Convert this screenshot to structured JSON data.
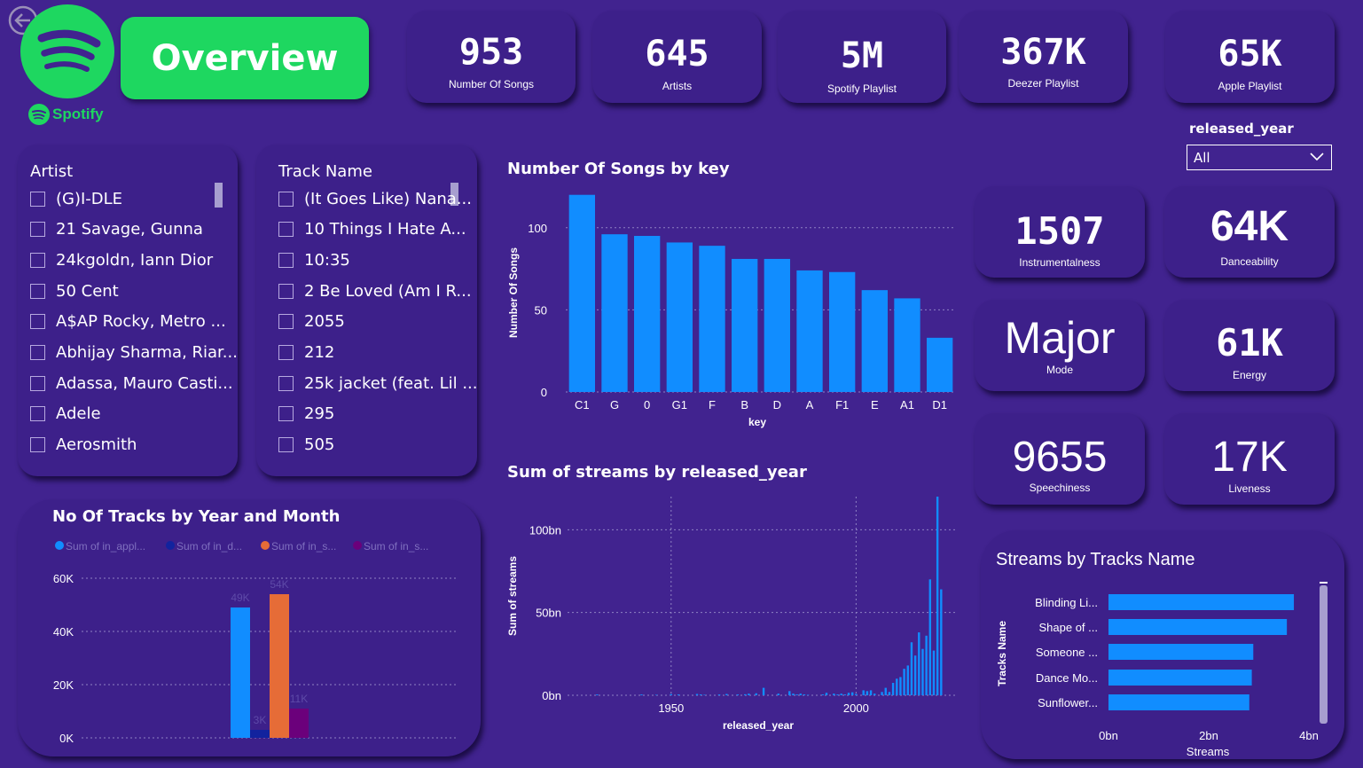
{
  "header": {
    "title": "Overview",
    "brand": "Spotify"
  },
  "kpis_top": [
    {
      "value": "953",
      "label": "Number Of Songs"
    },
    {
      "value": "645",
      "label": "Artists"
    },
    {
      "value": "5M",
      "label": "Spotify Playlist"
    },
    {
      "value": "367K",
      "label": "Deezer Playlist"
    },
    {
      "value": "65K",
      "label": "Apple Playlist"
    }
  ],
  "kpis_side": [
    {
      "value": "1507",
      "label": "Instrumentalness"
    },
    {
      "value": "64K",
      "label": "Danceability"
    },
    {
      "value": "Major",
      "label": "Mode"
    },
    {
      "value": "61K",
      "label": "Energy"
    },
    {
      "value": "9655",
      "label": "Speechiness"
    },
    {
      "value": "17K",
      "label": "Liveness"
    }
  ],
  "filter": {
    "label": "released_year",
    "value": "All"
  },
  "artist_slicer": {
    "title": "Artist",
    "items": [
      "(G)I-DLE",
      "21 Savage, Gunna",
      "24kgoldn, Iann Dior",
      "50 Cent",
      "A$AP Rocky, Metro ...",
      "Abhijay Sharma, Riar...",
      "Adassa, Mauro Casti...",
      "Adele",
      "Aerosmith"
    ]
  },
  "track_slicer": {
    "title": "Track Name",
    "items": [
      "(It Goes Like) Nana...",
      "10 Things I Hate A...",
      "10:35",
      "2 Be Loved (Am I R...",
      "2055",
      "212",
      "25k jacket (feat. Lil ...",
      "295",
      "505"
    ]
  },
  "colors": {
    "background": "#41238f",
    "card": "#3d208a",
    "accent_green": "#1ed760",
    "bar_blue": "#118dff",
    "orange": "#e66c37",
    "navy": "#12239e",
    "purple": "#6b007b"
  },
  "chart_data": [
    {
      "type": "bar",
      "title": "Number Of Songs by key",
      "xlabel": "key",
      "ylabel": "Number Of Songs",
      "categories": [
        "C1",
        "G",
        "0",
        "G1",
        "F",
        "B",
        "D",
        "A",
        "F1",
        "E",
        "A1",
        "D1"
      ],
      "values": [
        120,
        96,
        95,
        91,
        89,
        81,
        81,
        74,
        73,
        62,
        57,
        33
      ],
      "ylim": [
        0,
        122
      ],
      "yticks": [
        "0",
        "50",
        "100"
      ],
      "grid": true
    },
    {
      "type": "bar",
      "title": "Sum of streams by released_year",
      "xlabel": "released_year",
      "ylabel": "Sum of streams",
      "x": [
        1930,
        1942,
        1946,
        1950,
        1952,
        1957,
        1958,
        1959,
        1963,
        1965,
        1968,
        1970,
        1971,
        1973,
        1975,
        1979,
        1982,
        1983,
        1984,
        1985,
        1986,
        1987,
        1991,
        1992,
        1994,
        1995,
        1996,
        1997,
        1998,
        1999,
        2000,
        2002,
        2003,
        2004,
        2005,
        2007,
        2008,
        2009,
        2010,
        2011,
        2012,
        2013,
        2014,
        2015,
        2016,
        2017,
        2018,
        2019,
        2020,
        2021,
        2022,
        2023
      ],
      "values": [
        0.5,
        0.5,
        0.3,
        0.7,
        0.5,
        0.8,
        0.5,
        0.3,
        0.5,
        0.8,
        0.5,
        0.6,
        1.0,
        1.2,
        4.5,
        1.0,
        2.5,
        1.0,
        0.5,
        1.0,
        0.5,
        0.3,
        0.5,
        1.5,
        1.0,
        0.5,
        1.0,
        0.5,
        1.5,
        1.8,
        0.8,
        3.0,
        2.5,
        3.0,
        1.0,
        2.0,
        4.5,
        2.0,
        7.5,
        10.0,
        11.0,
        16.0,
        18.0,
        32.0,
        24.0,
        38.0,
        28.0,
        36.0,
        70.0,
        27.0,
        120.0,
        64.0
      ],
      "ylim": [
        0,
        120
      ],
      "yticks": [
        "0bn",
        "50bn",
        "100bn"
      ],
      "xticks": [
        "1950",
        "2000"
      ],
      "grid": true
    },
    {
      "type": "bar",
      "title": "No Of Tracks by Year and Month",
      "series": [
        {
          "name": "Sum of in_appl...",
          "values": [
            49000
          ]
        },
        {
          "name": "Sum of in_d...",
          "values": [
            3000
          ]
        },
        {
          "name": "Sum of in_s...",
          "values": [
            54000
          ]
        },
        {
          "name": "Sum of in_s...",
          "values": [
            11000
          ]
        }
      ],
      "data_labels": [
        "49K",
        "3K",
        "54K",
        "11K"
      ],
      "ylim": [
        0,
        60000
      ],
      "yticks": [
        "0K",
        "20K",
        "40K",
        "60K"
      ],
      "legend": "top",
      "grid": true
    },
    {
      "type": "bar",
      "orientation": "horizontal",
      "title": "Streams by Tracks Name",
      "xlabel": "Streams",
      "ylabel": "Tracks Name",
      "categories": [
        "Blinding Li...",
        "Shape of ...",
        "Someone ...",
        "Dance Mo...",
        "Sunflower..."
      ],
      "values": [
        3.7,
        3.56,
        2.89,
        2.86,
        2.81
      ],
      "xlim": [
        0,
        4
      ],
      "xticks": [
        "0bn",
        "2bn",
        "4bn"
      ]
    }
  ]
}
